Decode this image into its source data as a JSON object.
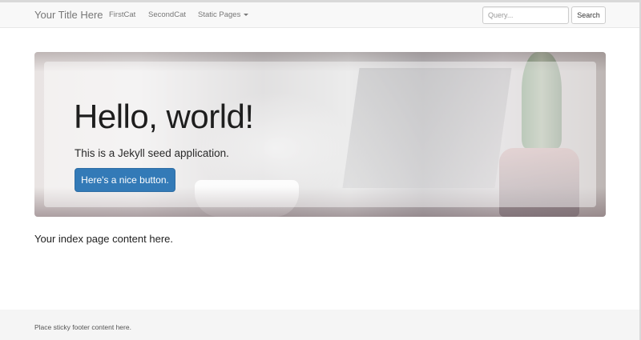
{
  "navbar": {
    "brand": "Your Title Here",
    "links": [
      {
        "label": "FirstCat"
      },
      {
        "label": "SecondCat"
      },
      {
        "label": "Static Pages",
        "has_dropdown": true
      }
    ],
    "search": {
      "placeholder": "Query...",
      "button_label": "Search"
    }
  },
  "jumbotron": {
    "heading": "Hello, world!",
    "lead": "This is a Jekyll seed application.",
    "button_label": "Here's a nice button.",
    "button_color": "#337ab7"
  },
  "main": {
    "content": "Your index page content here."
  },
  "footer": {
    "text": "Place sticky footer content here."
  },
  "icons": {
    "dropdown": "caret-down-icon"
  }
}
